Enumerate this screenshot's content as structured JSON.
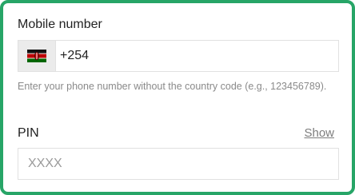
{
  "mobile": {
    "label": "Mobile number",
    "flag_icon": "kenya-flag-icon",
    "country_code": "+254",
    "help_text": "Enter your phone number without the country code (e.g., 123456789)."
  },
  "pin": {
    "label": "PIN",
    "show_label": "Show",
    "placeholder": "XXXX",
    "value": ""
  },
  "colors": {
    "border_accent": "#27a567",
    "link": "#7d7d7d",
    "help_text": "#8a8a8a"
  }
}
